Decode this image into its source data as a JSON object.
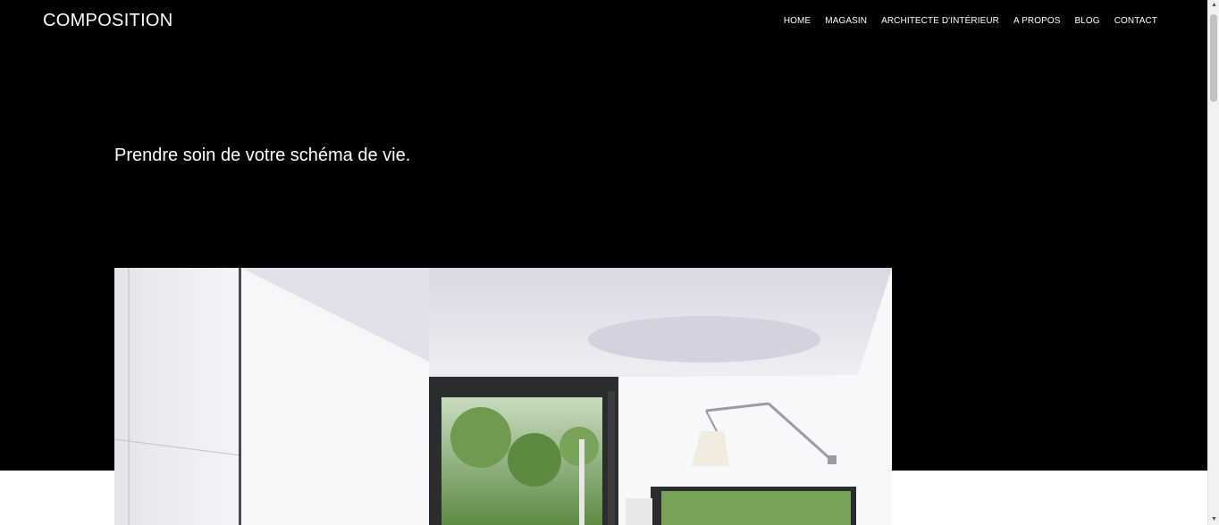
{
  "header": {
    "brand": "COMPOSITION",
    "nav": [
      "HOME",
      "MAGASIN",
      "ARCHITECTE D'INTÉRIEUR",
      "A PROPOS",
      "BLOG",
      "CONTACT"
    ]
  },
  "hero": {
    "tagline": "Prendre soin de votre schéma de vie."
  },
  "colors": {
    "hero_background": "#000000",
    "page_background": "#ffffff",
    "text": "#ffffff"
  },
  "icons": {
    "scroll_up": "triangle-up-icon",
    "scroll_down": "triangle-down-icon"
  }
}
